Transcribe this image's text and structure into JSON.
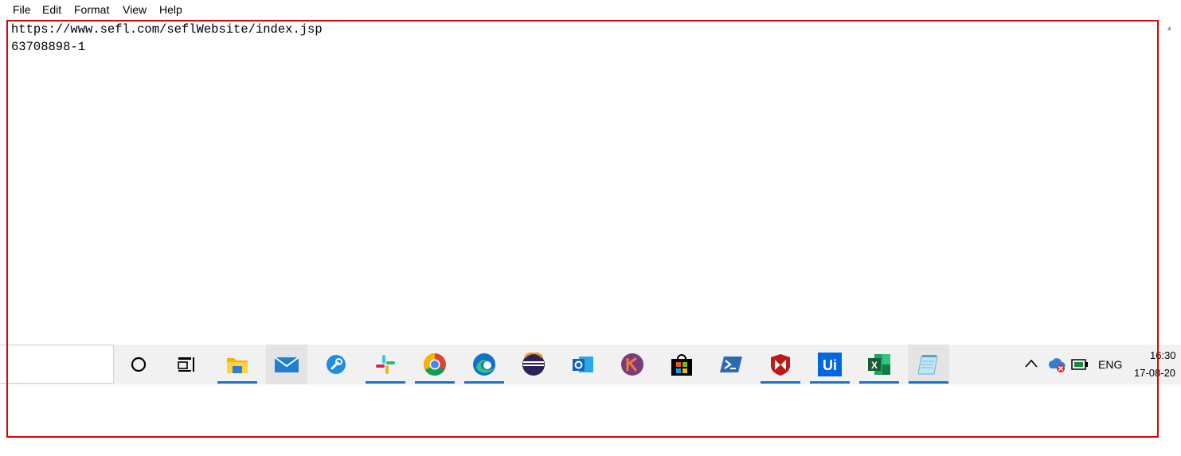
{
  "menubar": {
    "items": [
      "File",
      "Edit",
      "Format",
      "View",
      "Help"
    ]
  },
  "editor": {
    "lines": [
      "https://www.sefl.com/seflWebsite/index.jsp",
      "63708898-1"
    ]
  },
  "taskbar": {
    "accent_color": "#1e73c8",
    "apps": [
      {
        "name": "cortana-icon",
        "running": false
      },
      {
        "name": "task-view-icon",
        "running": false
      },
      {
        "name": "file-explorer-icon",
        "running": true
      },
      {
        "name": "mail-icon",
        "running": false,
        "active": true
      },
      {
        "name": "wrench-tool-icon",
        "running": false
      },
      {
        "name": "slack-icon",
        "running": true
      },
      {
        "name": "chrome-icon",
        "running": true
      },
      {
        "name": "edge-icon",
        "running": true
      },
      {
        "name": "eclipse-icon",
        "running": false
      },
      {
        "name": "outlook-icon",
        "running": false
      },
      {
        "name": "kotlin-app-icon",
        "running": false
      },
      {
        "name": "microsoft-store-icon",
        "running": false
      },
      {
        "name": "powershell-icon",
        "running": false
      },
      {
        "name": "mcafee-icon",
        "running": true
      },
      {
        "name": "uipath-icon",
        "running": true
      },
      {
        "name": "excel-icon",
        "running": true
      },
      {
        "name": "notepad-icon",
        "running": true,
        "active": true
      }
    ],
    "uipath_label": "Ui",
    "excel_label": "X"
  },
  "tray": {
    "language": "ENG",
    "time": "16:30",
    "date": "17-08-20"
  },
  "highlight_color": "#e00000"
}
